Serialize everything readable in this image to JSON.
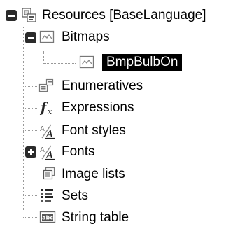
{
  "tree": {
    "root": {
      "label": "Resources [BaseLanguage]",
      "icon": "resource-group-icon",
      "expanded": true
    },
    "bitmaps": {
      "label": "Bitmaps",
      "icon": "image-icon",
      "expanded": true
    },
    "bmp_bulb_on": {
      "label": "BmpBulbOn",
      "icon": "image-icon",
      "selected": true
    },
    "enumeratives": {
      "label": "Enumeratives",
      "icon": "enum-icon"
    },
    "expressions": {
      "label": "Expressions",
      "icon": "function-fx-icon"
    },
    "font_styles": {
      "label": "Font styles",
      "icon": "font-style-icon"
    },
    "fonts": {
      "label": "Fonts",
      "icon": "font-icon",
      "expanded": false
    },
    "image_lists": {
      "label": "Image lists",
      "icon": "image-list-icon"
    },
    "sets": {
      "label": "Sets",
      "icon": "list-set-icon"
    },
    "string_table": {
      "label": "String table",
      "icon": "string-table-icon"
    }
  }
}
